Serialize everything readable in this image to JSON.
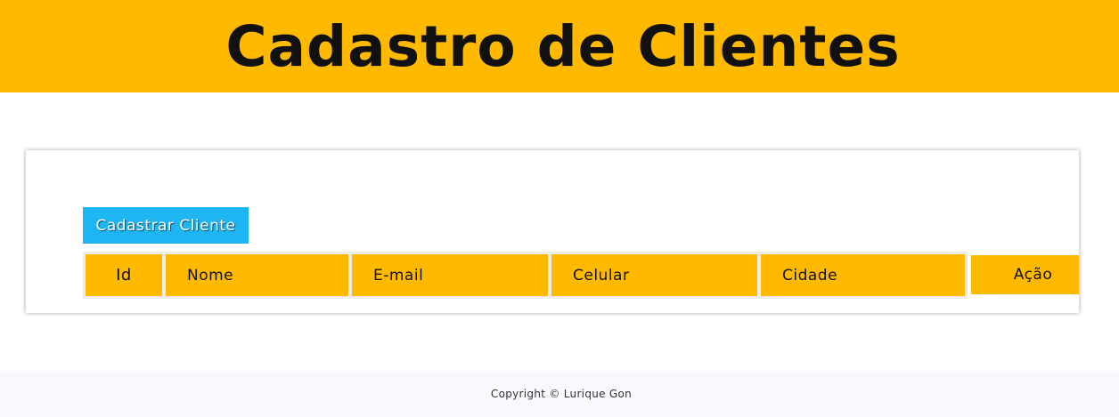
{
  "header": {
    "title": "Cadastro de Clientes"
  },
  "card": {
    "add_button_label": "Cadastrar Cliente",
    "table": {
      "columns": [
        "Id",
        "Nome",
        "E-mail",
        "Celular",
        "Cidade",
        "Ação"
      ]
    }
  },
  "footer": {
    "copyright": "Copyright © Lurique Gon"
  },
  "colors": {
    "header_bg": "#ffba00",
    "button_bg": "#1fb5f3",
    "table_header_bg": "#ffba00",
    "footer_bg": "#f8f9fc"
  }
}
